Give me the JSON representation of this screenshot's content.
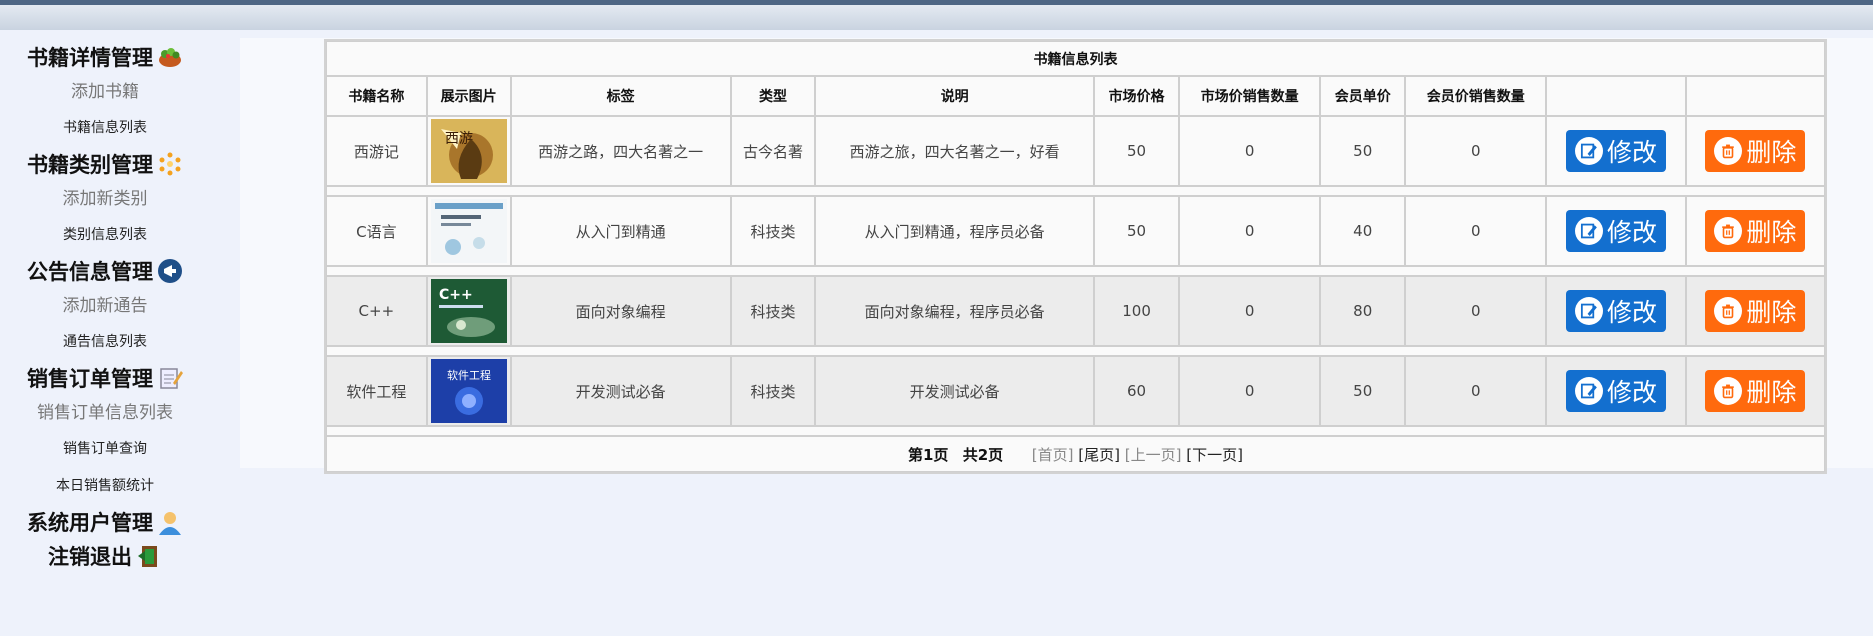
{
  "sidebar": {
    "sections": [
      {
        "title": "书籍详情管理",
        "icon": "salad-bowl-icon",
        "links": [
          {
            "label": "添加书籍",
            "style": "big"
          },
          {
            "label": "书籍信息列表",
            "style": "small"
          }
        ]
      },
      {
        "title": "书籍类别管理",
        "icon": "sparkle-icon",
        "links": [
          {
            "label": "添加新类别",
            "style": "big"
          },
          {
            "label": "类别信息列表",
            "style": "small"
          }
        ]
      },
      {
        "title": "公告信息管理",
        "icon": "megaphone-icon",
        "links": [
          {
            "label": "添加新通告",
            "style": "big"
          },
          {
            "label": "通告信息列表",
            "style": "small"
          }
        ]
      },
      {
        "title": "销售订单管理",
        "icon": "notepad-icon",
        "links": [
          {
            "label": "销售订单信息列表",
            "style": "big"
          },
          {
            "label": "销售订单查询",
            "style": "small"
          },
          {
            "label": "本日销售额统计",
            "style": "small"
          }
        ]
      },
      {
        "title": "系统用户管理",
        "icon": "user-icon",
        "links": []
      },
      {
        "title": "注销退出",
        "icon": "exit-door-icon",
        "links": []
      }
    ]
  },
  "table": {
    "caption": "书籍信息列表",
    "headers": [
      "书籍名称",
      "展示图片",
      "标签",
      "类型",
      "说明",
      "市场价格",
      "市场价销售数量",
      "会员单价",
      "会员价销售数量",
      "",
      ""
    ],
    "rows": [
      {
        "name": "西游记",
        "cover": "journey-west-cover",
        "tag": "西游之路，四大名著之一",
        "type": "古今名著",
        "desc": "西游之旅，四大名著之一，好看",
        "market_price": "50",
        "market_sold": "0",
        "member_price": "50",
        "member_sold": "0"
      },
      {
        "name": "C语言",
        "cover": "c-language-cover",
        "tag": "从入门到精通",
        "type": "科技类",
        "desc": "从入门到精通，程序员必备",
        "market_price": "50",
        "market_sold": "0",
        "member_price": "40",
        "member_sold": "0"
      },
      {
        "name": "C++",
        "cover": "cpp-cover",
        "tag": "面向对象编程",
        "type": "科技类",
        "desc": "面向对象编程，程序员必备",
        "market_price": "100",
        "market_sold": "0",
        "member_price": "80",
        "member_sold": "0"
      },
      {
        "name": "软件工程",
        "cover": "software-eng-cover",
        "tag": "开发测试必备",
        "type": "科技类",
        "desc": "开发测试必备",
        "market_price": "60",
        "market_sold": "0",
        "member_price": "50",
        "member_sold": "0"
      }
    ],
    "edit_label": "修改",
    "delete_label": "删除"
  },
  "pager": {
    "current": "第1页",
    "total": "共2页",
    "first": "[首页]",
    "last": "[尾页]",
    "prev": "[上一页]",
    "next": "[下一页]"
  },
  "colors": {
    "edit_button": "#136fcf",
    "delete_button": "#ff6a0d"
  }
}
